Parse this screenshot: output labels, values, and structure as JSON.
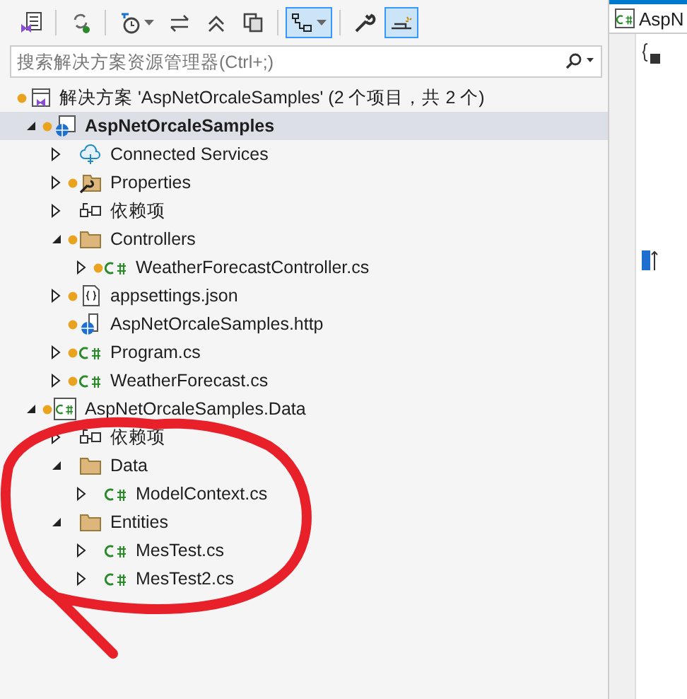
{
  "toolbar": {
    "buttons": [
      {
        "kind": "vs-home",
        "selected": false
      },
      {
        "kind": "sync",
        "selected": false
      },
      {
        "kind": "history",
        "selected": false,
        "dropdown": true
      },
      {
        "kind": "swap",
        "selected": false
      },
      {
        "kind": "collapse",
        "selected": false
      },
      {
        "kind": "pages",
        "selected": false
      },
      {
        "kind": "tree",
        "selected": true,
        "dropdown": true
      },
      {
        "kind": "wrench",
        "selected": false
      },
      {
        "kind": "preview",
        "selected": true
      }
    ]
  },
  "search": {
    "placeholder": "搜索解决方案资源管理器(Ctrl+;)"
  },
  "tree": [
    {
      "label": "解决方案 'AspNetOrcaleSamples' (2 个项目，共 2 个)",
      "kind": "solution",
      "status_dot": true,
      "bold": false,
      "selected": false,
      "children": [
        {
          "label": "AspNetOrcaleSamples",
          "kind": "web-project",
          "expanded": true,
          "status_dot": true,
          "bold": true,
          "selected": true,
          "children": [
            {
              "label": "Connected Services",
              "kind": "cloud",
              "expanded": false,
              "status_dot": false,
              "bold": false,
              "selected": false
            },
            {
              "label": "Properties",
              "kind": "wrench-folder",
              "expanded": false,
              "status_dot": true,
              "bold": false,
              "selected": false
            },
            {
              "label": "依赖项",
              "kind": "dependencies",
              "expanded": false,
              "status_dot": false,
              "bold": false,
              "selected": false
            },
            {
              "label": "Controllers",
              "kind": "folder",
              "expanded": true,
              "status_dot": true,
              "bold": false,
              "selected": false,
              "children": [
                {
                  "label": "WeatherForecastController.cs",
                  "kind": "csharp",
                  "expanded": false,
                  "status_dot": true,
                  "bold": false,
                  "selected": false
                }
              ]
            },
            {
              "label": "appsettings.json",
              "kind": "json",
              "expanded": false,
              "status_dot": true,
              "bold": false,
              "selected": false
            },
            {
              "label": "AspNetOrcaleSamples.http",
              "kind": "http",
              "status_dot": true,
              "bold": false,
              "selected": false
            },
            {
              "label": "Program.cs",
              "kind": "csharp",
              "expanded": false,
              "status_dot": true,
              "bold": false,
              "selected": false
            },
            {
              "label": "WeatherForecast.cs",
              "kind": "csharp",
              "expanded": false,
              "status_dot": true,
              "bold": false,
              "selected": false
            }
          ]
        },
        {
          "label": "AspNetOrcaleSamples.Data",
          "kind": "csharp-project",
          "expanded": true,
          "status_dot": true,
          "bold": false,
          "selected": false,
          "children": [
            {
              "label": "依赖项",
              "kind": "dependencies",
              "expanded": false,
              "status_dot": false,
              "bold": false,
              "selected": false
            },
            {
              "label": "Data",
              "kind": "folder",
              "expanded": true,
              "status_dot": false,
              "bold": false,
              "selected": false,
              "children": [
                {
                  "label": "ModelContext.cs",
                  "kind": "csharp",
                  "expanded": false,
                  "status_dot": false,
                  "bold": false,
                  "selected": false
                }
              ]
            },
            {
              "label": "Entities",
              "kind": "folder",
              "expanded": true,
              "status_dot": false,
              "bold": false,
              "selected": false,
              "children": [
                {
                  "label": "MesTest.cs",
                  "kind": "csharp",
                  "expanded": false,
                  "status_dot": false,
                  "bold": false,
                  "selected": false
                },
                {
                  "label": "MesTest2.cs",
                  "kind": "csharp",
                  "expanded": false,
                  "status_dot": false,
                  "bold": false,
                  "selected": false
                }
              ]
            }
          ]
        }
      ]
    }
  ],
  "editor": {
    "tab": {
      "label": "AspN"
    }
  }
}
